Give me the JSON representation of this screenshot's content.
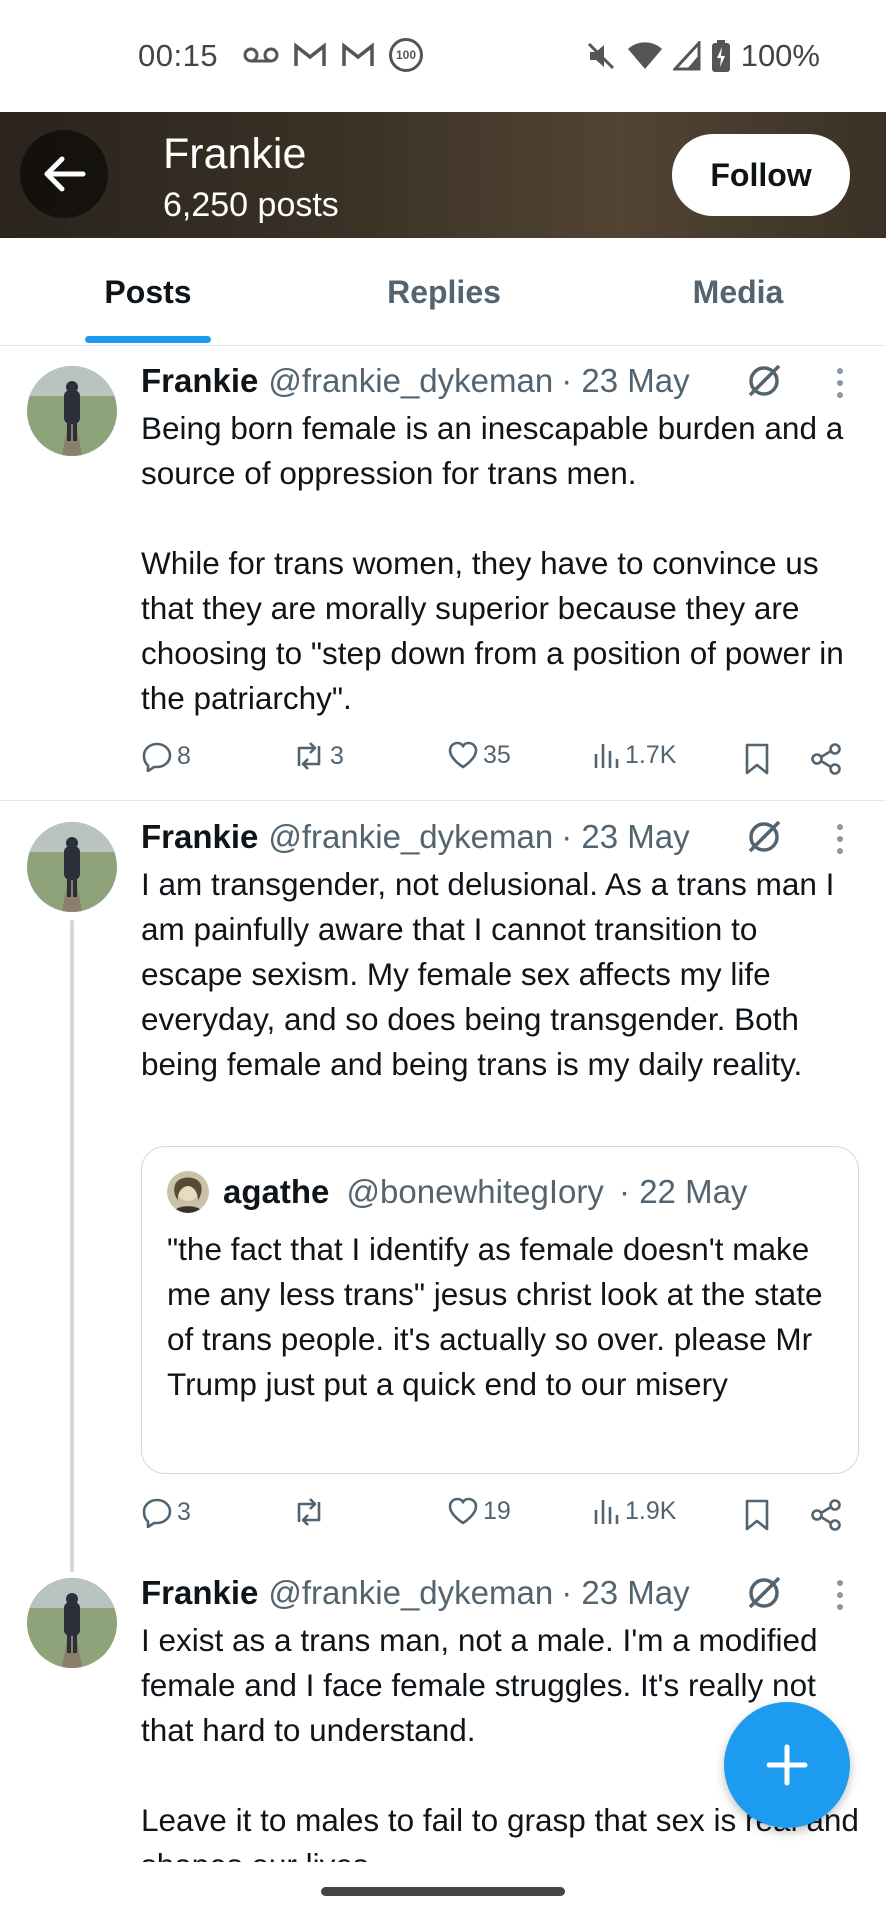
{
  "status_bar": {
    "time": "00:15",
    "battery": "100%",
    "icons": [
      "voicemail-icon",
      "gmail-icon",
      "gmail-icon",
      "notification-count-icon",
      "mute-icon",
      "wifi-icon",
      "signal-icon",
      "battery-charging-icon"
    ],
    "notification_count": "100"
  },
  "header": {
    "name": "Frankie",
    "posts_count": "6,250 posts",
    "follow_label": "Follow"
  },
  "tabs": [
    {
      "label": "Posts",
      "active": true
    },
    {
      "label": "Replies",
      "active": false
    },
    {
      "label": "Media",
      "active": false
    }
  ],
  "tweets": [
    {
      "name": "Frankie",
      "handle": "@frankie_dykeman",
      "date": "· 23 May",
      "text": "Being born female is an inescapable burden and a source of oppression for trans men.\n\nWhile for trans women, they have to convince us that they are morally superior because they are choosing to \"step down from a position of power in the patriarchy\".",
      "replies": "8",
      "reposts": "3",
      "likes": "35",
      "views": "1.7K"
    },
    {
      "name": "Frankie",
      "handle": "@frankie_dykeman",
      "date": "· 23 May",
      "text": "I am transgender, not delusional. As a trans man I am painfully aware that I cannot transition to escape sexism. My female sex affects my life everyday, and so does being transgender. Both being female and being trans is my daily reality.",
      "quote": {
        "name": "agathe",
        "handle": "@bonewhitegIory",
        "date": "· 22 May",
        "text": "\"the fact that I identify as female doesn't make me any less trans\" jesus christ look at the state of trans people. it's actually so over. please Mr Trump just put a quick end to our misery"
      },
      "replies": "3",
      "reposts": "",
      "likes": "19",
      "views": "1.9K"
    },
    {
      "name": "Frankie",
      "handle": "@frankie_dykeman",
      "date": "· 23 May",
      "text": "I exist as a trans man, not a male. I'm a modified female and I face female struggles. It's really not that hard to understand.\n\nLeave it to males to fail to grasp that sex is real and shapes our lives"
    }
  ],
  "colors": {
    "accent": "#1d9bf0",
    "text_primary": "#0f1419",
    "text_secondary": "#536471",
    "border": "#e6e8ea"
  }
}
